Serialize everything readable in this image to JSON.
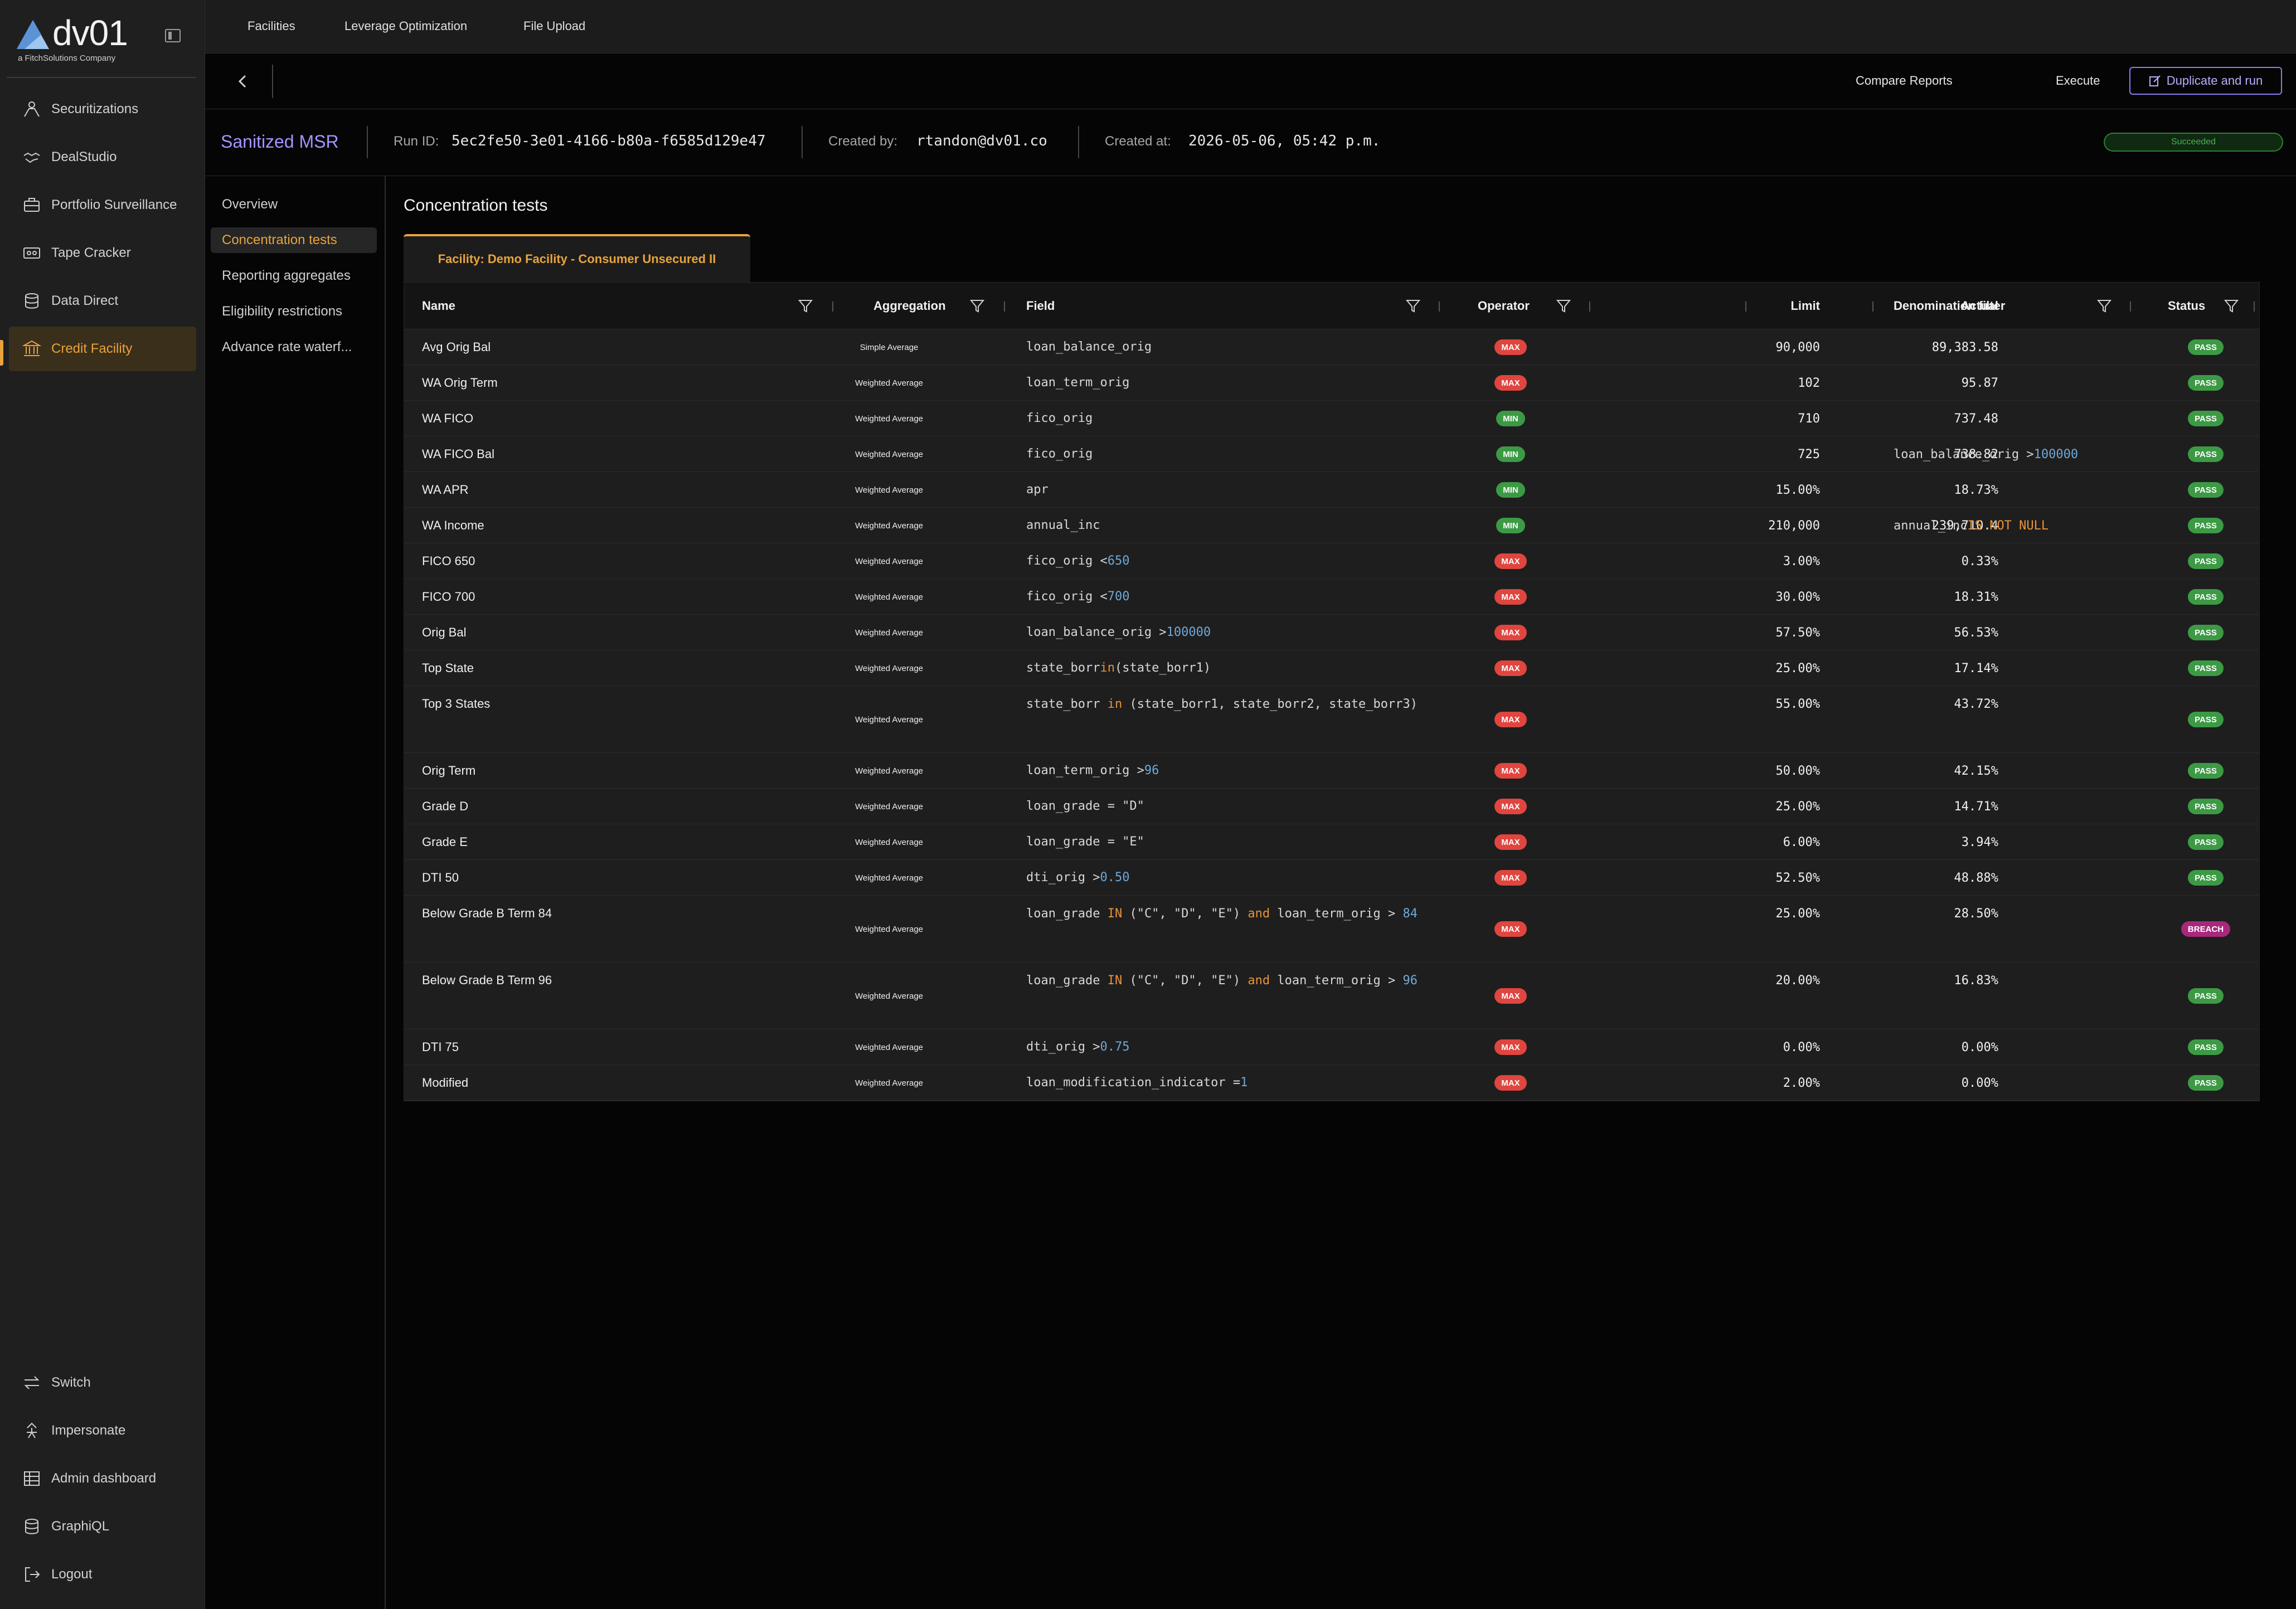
{
  "brand": {
    "name": "dv01",
    "tagline": "a FitchSolutions Company"
  },
  "sidebar": {
    "items": [
      {
        "label": "Securitizations",
        "icon": "securitizations-icon"
      },
      {
        "label": "DealStudio",
        "icon": "handshake-icon"
      },
      {
        "label": "Portfolio Surveillance",
        "icon": "briefcase-icon"
      },
      {
        "label": "Tape Cracker",
        "icon": "cassette-icon"
      },
      {
        "label": "Data Direct",
        "icon": "database-icon"
      },
      {
        "label": "Credit Facility",
        "icon": "bank-icon"
      }
    ],
    "bottom": [
      {
        "label": "Switch",
        "icon": "switch-arrows-icon"
      },
      {
        "label": "Impersonate",
        "icon": "spy-icon"
      },
      {
        "label": "Admin dashboard",
        "icon": "table-icon"
      },
      {
        "label": "GraphiQL",
        "icon": "database-icon"
      },
      {
        "label": "Logout",
        "icon": "logout-icon"
      }
    ]
  },
  "topnav": {
    "tabs": [
      "Facilities",
      "Leverage Optimization",
      "File Upload"
    ]
  },
  "actions": {
    "compare": "Compare Reports",
    "execute": "Execute",
    "duplicate": "Duplicate and run"
  },
  "report": {
    "title": "Sanitized MSR",
    "run_id_label": "Run ID:",
    "run_id": "5ec2fe50-3e01-4166-b80a-f6585d129e47",
    "created_by_label": "Created by:",
    "created_by": "rtandon@dv01.co",
    "created_at_label": "Created at:",
    "created_at": "2026-05-06, 05:42 p.m.",
    "status": "Succeeded"
  },
  "subnav": {
    "items": [
      "Overview",
      "Concentration tests",
      "Reporting aggregates",
      "Eligibility restrictions",
      "Advance rate waterf..."
    ],
    "active": 1
  },
  "main": {
    "section_title": "Concentration tests",
    "facility_tab": "Facility: Demo Facility - Consumer Unsecured II"
  },
  "table": {
    "columns": {
      "name": "Name",
      "aggregation": "Aggregation",
      "field": "Field",
      "operator": "Operator",
      "limit": "Limit",
      "actual": "Actual",
      "denomination": "Denomination filter",
      "status": "Status"
    },
    "rows": [
      {
        "name": "Avg Orig Bal",
        "agg": "Simple Average",
        "field": [
          [
            "loan_balance_orig",
            ""
          ]
        ],
        "op": "MAX",
        "limit": "90,000",
        "actual": "89,383.58",
        "den": [],
        "status": "PASS"
      },
      {
        "name": "WA Orig Term",
        "agg": "Weighted Average",
        "field": [
          [
            "loan_term_orig",
            ""
          ]
        ],
        "op": "MAX",
        "limit": "102",
        "actual": "95.87",
        "den": [],
        "status": "PASS"
      },
      {
        "name": "WA FICO",
        "agg": "Weighted Average",
        "field": [
          [
            "fico_orig",
            ""
          ]
        ],
        "op": "MIN",
        "limit": "710",
        "actual": "737.48",
        "den": [],
        "status": "PASS"
      },
      {
        "name": "WA FICO Bal",
        "agg": "Weighted Average",
        "field": [
          [
            "fico_orig",
            ""
          ]
        ],
        "op": "MIN",
        "limit": "725",
        "actual": "738.82",
        "den": [
          [
            "loan_balance_orig > ",
            ""
          ],
          [
            "100000",
            "num"
          ]
        ],
        "status": "PASS"
      },
      {
        "name": "WA APR",
        "agg": "Weighted Average",
        "field": [
          [
            "apr",
            ""
          ]
        ],
        "op": "MIN",
        "limit": "15.00%",
        "actual": "18.73%",
        "den": [],
        "status": "PASS"
      },
      {
        "name": "WA Income",
        "agg": "Weighted Average",
        "field": [
          [
            "annual_inc",
            ""
          ]
        ],
        "op": "MIN",
        "limit": "210,000",
        "actual": "239,710.4",
        "den": [
          [
            "annual_inc ",
            ""
          ],
          [
            "IS NOT NULL",
            "kw"
          ]
        ],
        "status": "PASS"
      },
      {
        "name": "FICO 650",
        "agg": "Weighted Average",
        "field": [
          [
            "fico_orig < ",
            ""
          ],
          [
            "650",
            "num"
          ]
        ],
        "op": "MAX",
        "limit": "3.00%",
        "actual": "0.33%",
        "den": [],
        "status": "PASS"
      },
      {
        "name": "FICO 700",
        "agg": "Weighted Average",
        "field": [
          [
            "fico_orig < ",
            ""
          ],
          [
            "700",
            "num"
          ]
        ],
        "op": "MAX",
        "limit": "30.00%",
        "actual": "18.31%",
        "den": [],
        "status": "PASS"
      },
      {
        "name": "Orig Bal",
        "agg": "Weighted Average",
        "field": [
          [
            "loan_balance_orig > ",
            ""
          ],
          [
            "100000",
            "num"
          ]
        ],
        "op": "MAX",
        "limit": "57.50%",
        "actual": "56.53%",
        "den": [],
        "status": "PASS"
      },
      {
        "name": "Top State",
        "agg": "Weighted Average",
        "field": [
          [
            "state_borr ",
            ""
          ],
          [
            "in",
            "kw"
          ],
          [
            " (state_borr1)",
            ""
          ]
        ],
        "op": "MAX",
        "limit": "25.00%",
        "actual": "17.14%",
        "den": [],
        "status": "PASS"
      },
      {
        "name": "Top 3 States",
        "agg": "Weighted Average",
        "field": [
          [
            "state_borr ",
            ""
          ],
          [
            "in",
            "kw"
          ],
          [
            " (state_borr1, state_borr2, state_borr3)",
            ""
          ]
        ],
        "op": "MAX",
        "limit": "55.00%",
        "actual": "43.72%",
        "den": [],
        "status": "PASS",
        "tall": true
      },
      {
        "name": "Orig Term",
        "agg": "Weighted Average",
        "field": [
          [
            "loan_term_orig > ",
            ""
          ],
          [
            "96",
            "num"
          ]
        ],
        "op": "MAX",
        "limit": "50.00%",
        "actual": "42.15%",
        "den": [],
        "status": "PASS"
      },
      {
        "name": "Grade D",
        "agg": "Weighted Average",
        "field": [
          [
            "loan_grade = \"D\"",
            ""
          ]
        ],
        "op": "MAX",
        "limit": "25.00%",
        "actual": "14.71%",
        "den": [],
        "status": "PASS"
      },
      {
        "name": "Grade E",
        "agg": "Weighted Average",
        "field": [
          [
            "loan_grade = \"E\"",
            ""
          ]
        ],
        "op": "MAX",
        "limit": "6.00%",
        "actual": "3.94%",
        "den": [],
        "status": "PASS"
      },
      {
        "name": "DTI 50",
        "agg": "Weighted Average",
        "field": [
          [
            "dti_orig > ",
            ""
          ],
          [
            "0.50",
            "num"
          ]
        ],
        "op": "MAX",
        "limit": "52.50%",
        "actual": "48.88%",
        "den": [],
        "status": "PASS"
      },
      {
        "name": "Below Grade B Term 84",
        "agg": "Weighted Average",
        "field": [
          [
            "loan_grade ",
            ""
          ],
          [
            "IN",
            "kw"
          ],
          [
            " (\"C\", \"D\", \"E\") ",
            ""
          ],
          [
            "and",
            "kw"
          ],
          [
            " loan_term_orig > ",
            ""
          ],
          [
            "84",
            "num"
          ]
        ],
        "op": "MAX",
        "limit": "25.00%",
        "actual": "28.50%",
        "den": [],
        "status": "BREACH",
        "tall": true
      },
      {
        "name": "Below Grade B Term 96",
        "agg": "Weighted Average",
        "field": [
          [
            "loan_grade ",
            ""
          ],
          [
            "IN",
            "kw"
          ],
          [
            " (\"C\", \"D\", \"E\") ",
            ""
          ],
          [
            "and",
            "kw"
          ],
          [
            " loan_term_orig > ",
            ""
          ],
          [
            "96",
            "num"
          ]
        ],
        "op": "MAX",
        "limit": "20.00%",
        "actual": "16.83%",
        "den": [],
        "status": "PASS",
        "tall": true
      },
      {
        "name": "DTI 75",
        "agg": "Weighted Average",
        "field": [
          [
            "dti_orig > ",
            ""
          ],
          [
            "0.75",
            "num"
          ]
        ],
        "op": "MAX",
        "limit": "0.00%",
        "actual": "0.00%",
        "den": [],
        "status": "PASS"
      },
      {
        "name": "Modified",
        "agg": "Weighted Average",
        "field": [
          [
            "loan_modification_indicator = ",
            ""
          ],
          [
            "1",
            "num"
          ]
        ],
        "op": "MAX",
        "limit": "2.00%",
        "actual": "0.00%",
        "den": [],
        "status": "PASS"
      }
    ]
  },
  "colors": {
    "accent": "#e8a33c",
    "brand_purple": "#a394ff",
    "max": "#e0453f",
    "pass": "#3c9a45",
    "breach": "#a8287c"
  }
}
